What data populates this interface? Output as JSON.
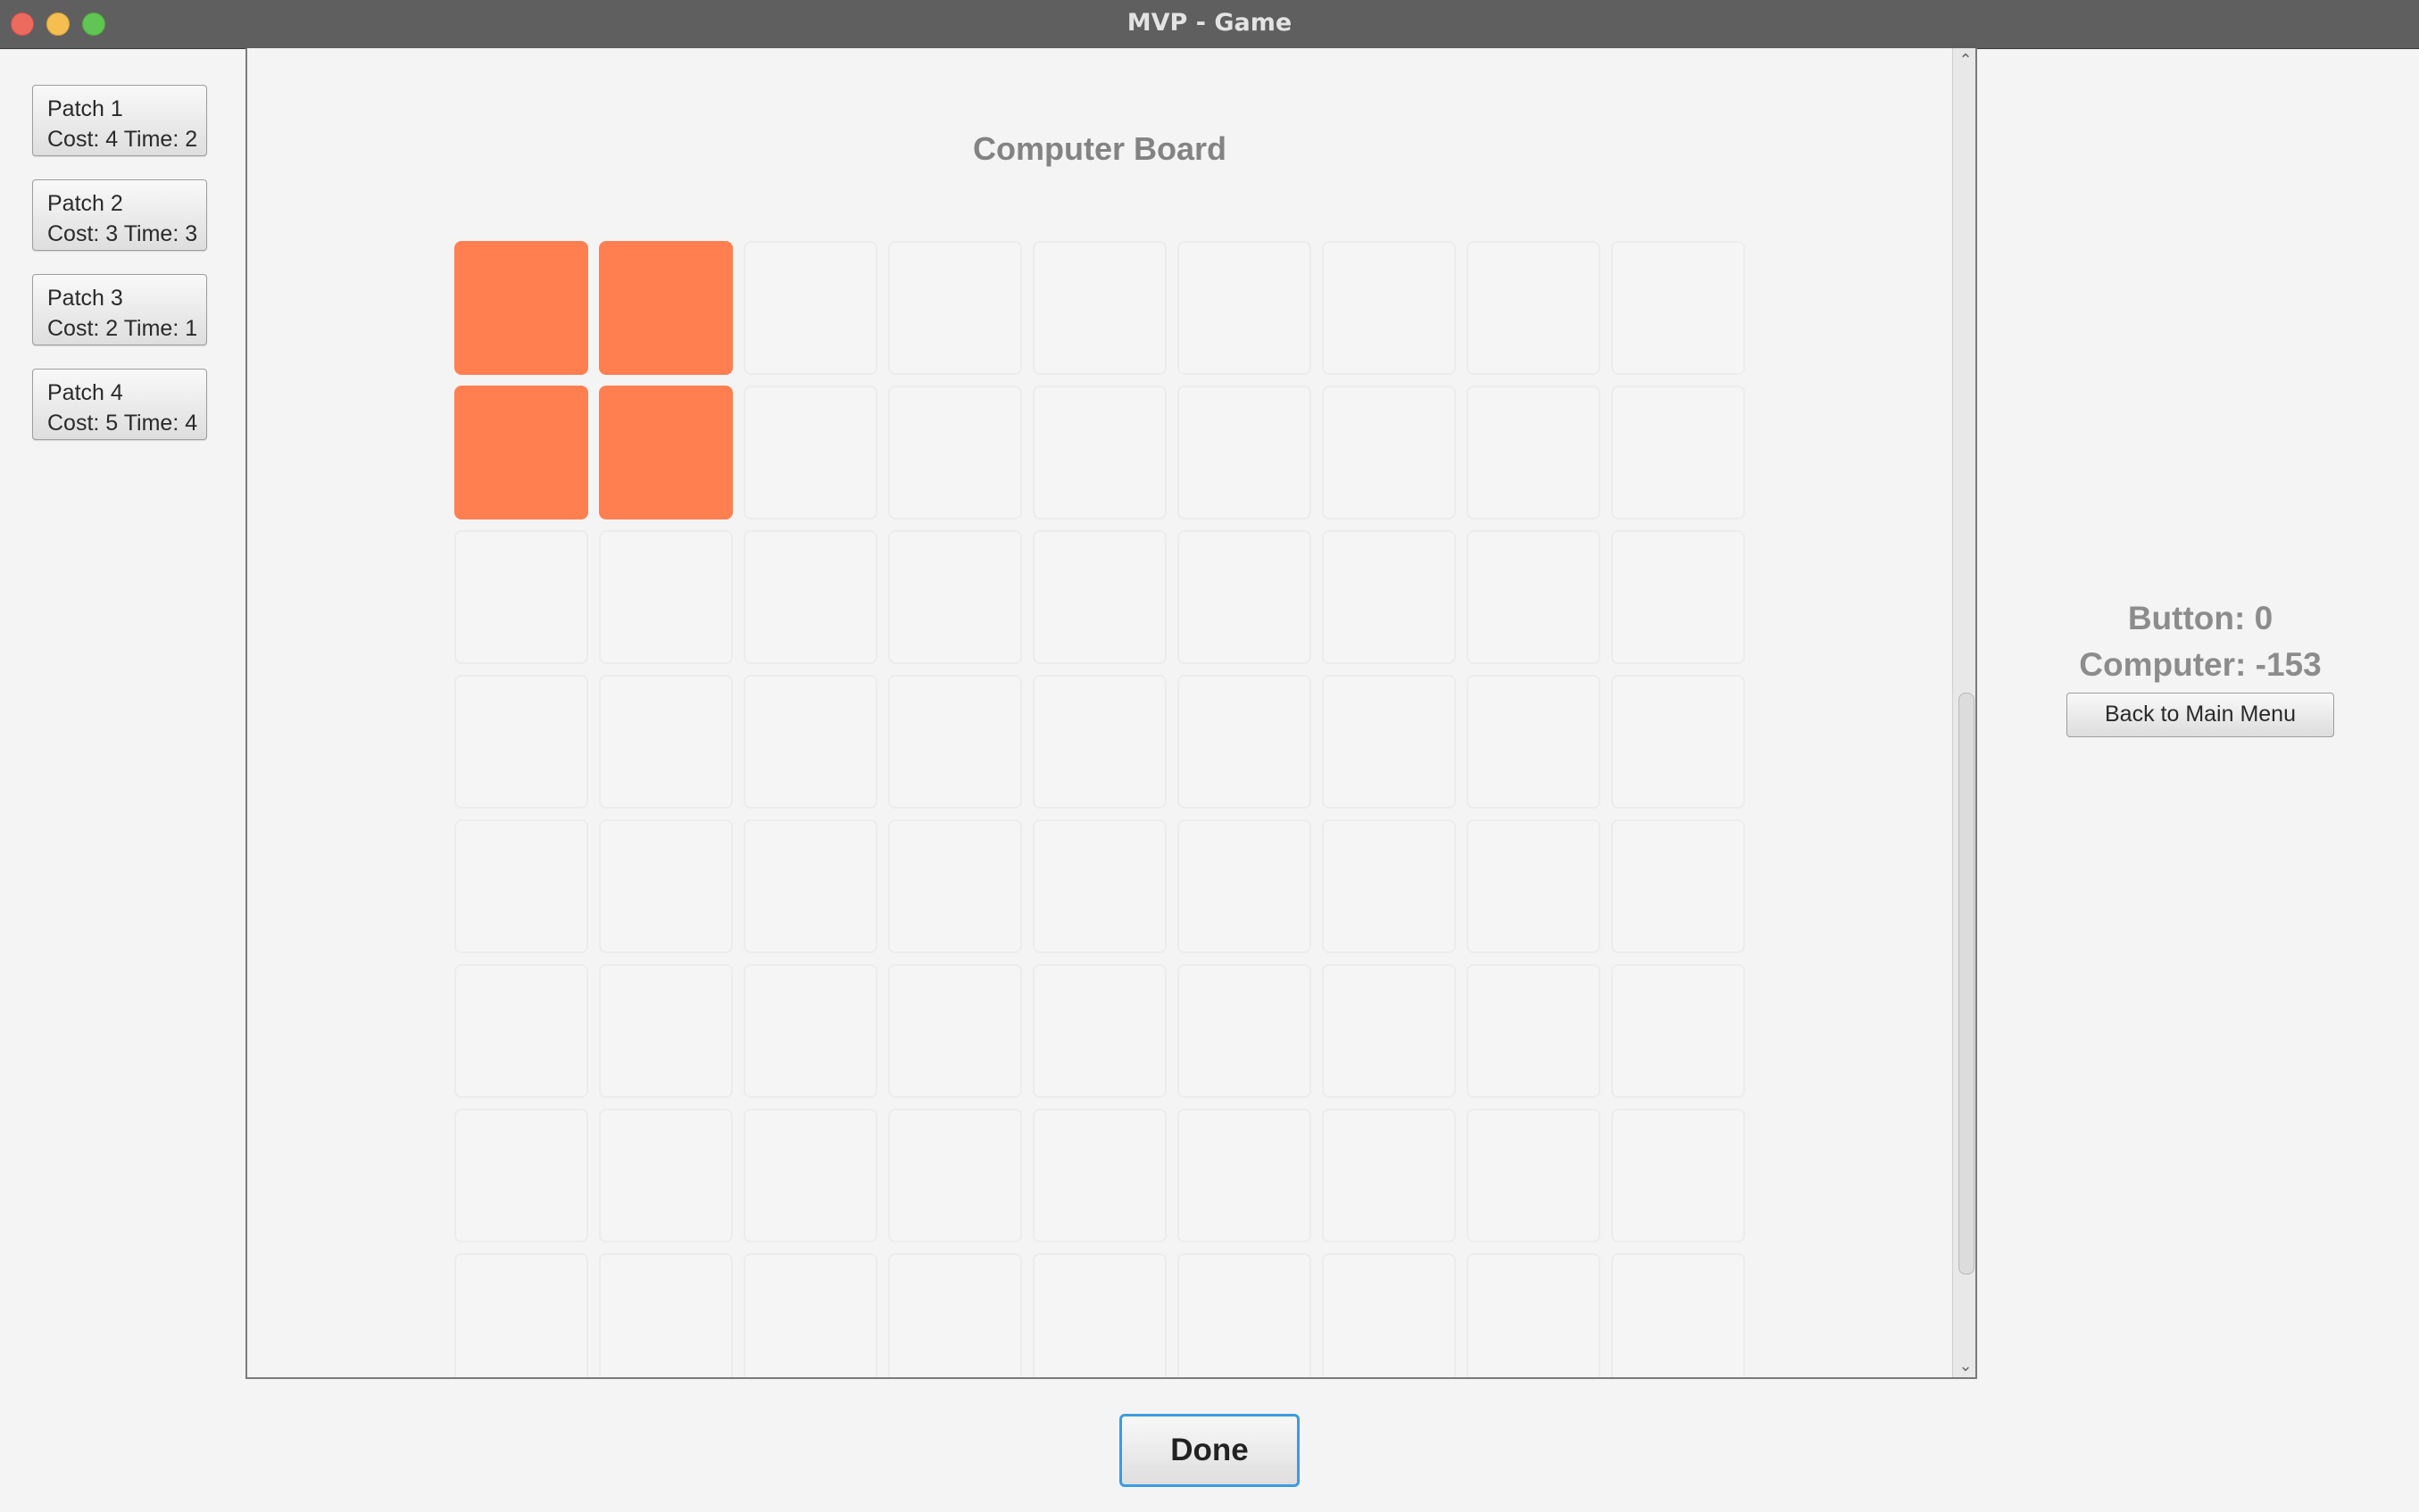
{
  "window": {
    "title": "MVP - Game"
  },
  "patches": [
    {
      "name": "Patch 1",
      "info": "Cost: 4 Time: 2"
    },
    {
      "name": "Patch 2",
      "info": "Cost: 3 Time: 3"
    },
    {
      "name": "Patch 3",
      "info": "Cost: 2 Time: 1"
    },
    {
      "name": "Patch 4",
      "info": "Cost: 5 Time: 4"
    }
  ],
  "board": {
    "title": "Computer Board",
    "filled_color": "#ff7f50",
    "filled_cells": [
      [
        0,
        0
      ],
      [
        0,
        1
      ],
      [
        1,
        0
      ],
      [
        1,
        1
      ]
    ]
  },
  "status": {
    "button_score": "Button: 0",
    "computer_score": "Computer: -153",
    "back_label": "Back to Main Menu"
  },
  "actions": {
    "done_label": "Done"
  }
}
